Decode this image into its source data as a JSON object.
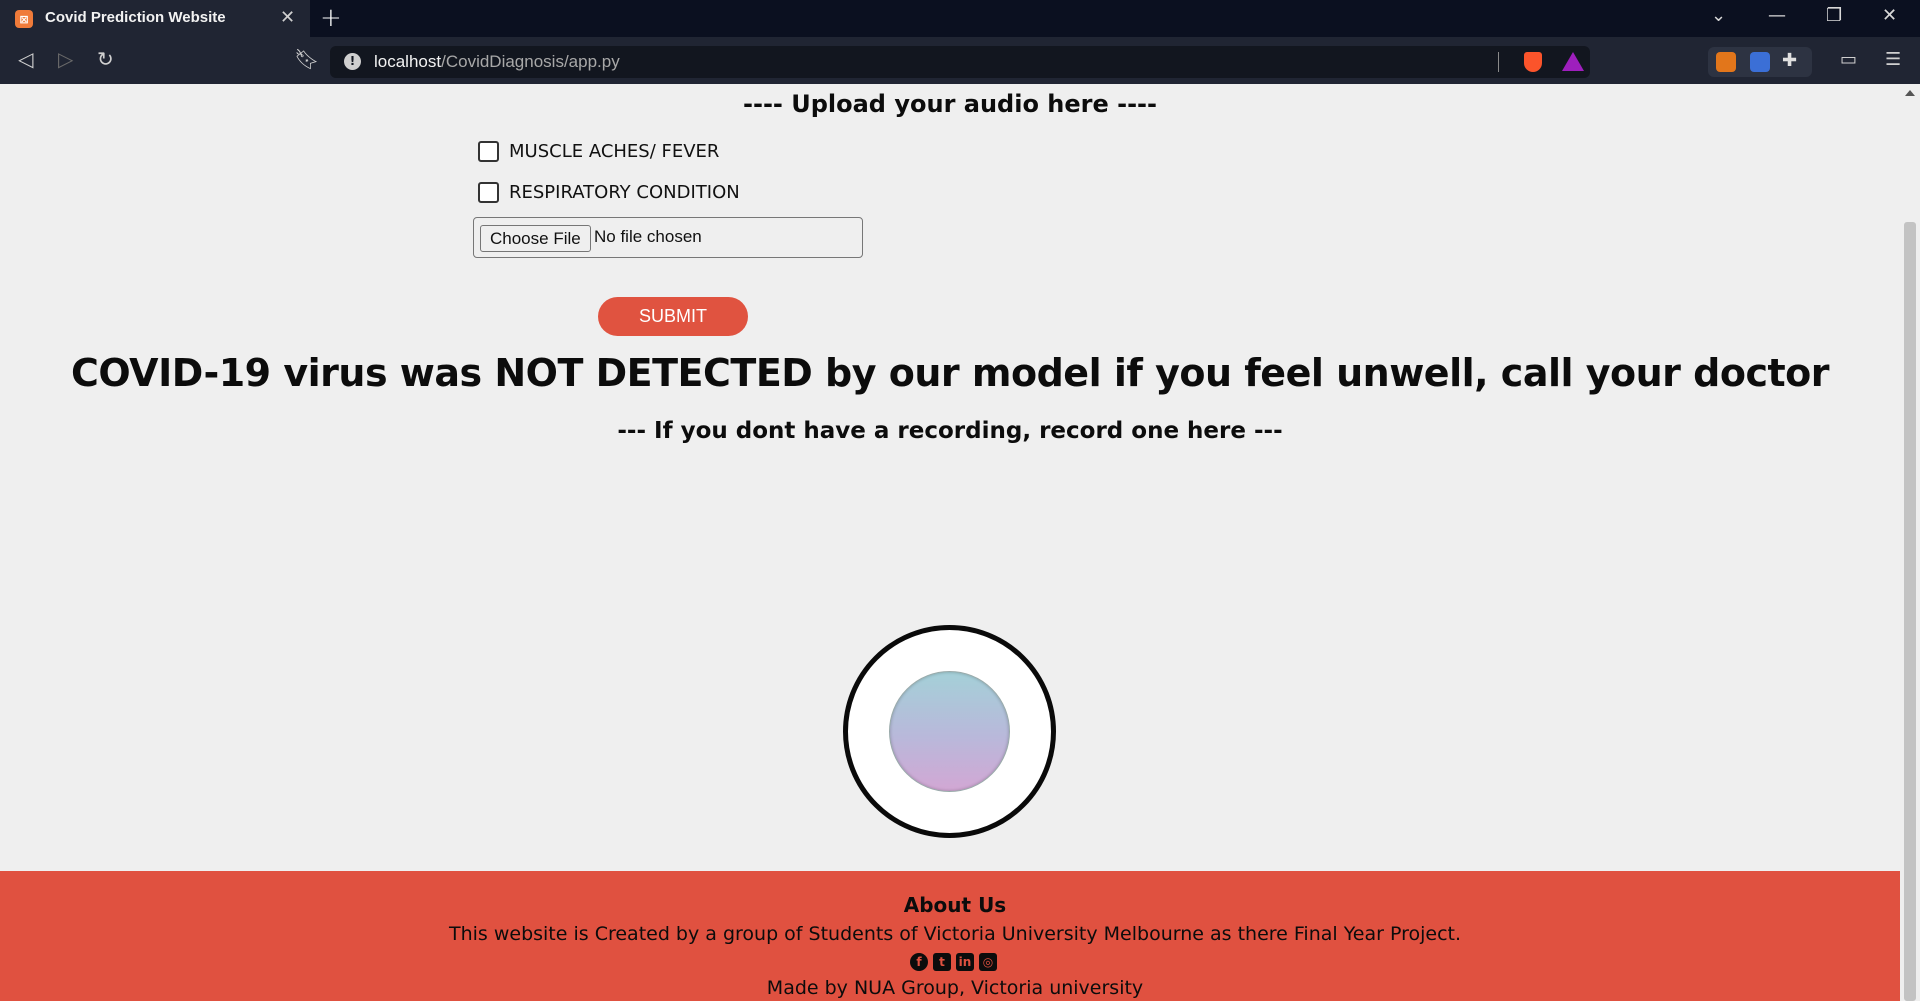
{
  "browser": {
    "tab_title": "Covid Prediction Website",
    "tab_favicon": "xampp-icon",
    "url_host": "localhost",
    "url_path": "/CovidDiagnosis/app.py"
  },
  "page": {
    "upload_title": "---- Upload your audio here ----",
    "checkboxes": [
      {
        "label": "MUSCLE ACHES/ FEVER",
        "checked": false
      },
      {
        "label": "RESPIRATORY CONDITION",
        "checked": false
      }
    ],
    "file_input": {
      "button_label": "Choose File",
      "status": "No file chosen"
    },
    "submit_label": "SUBMIT",
    "result_text": "COVID-19 virus was NOT DETECTED by our model if you feel unwell, call your doctor",
    "record_title": "--- If you dont have a recording, record one here ---"
  },
  "footer": {
    "title": "About Us",
    "description": "This website is Created by a group of Students of Victoria University Melbourne as there Final Year Project.",
    "social_icons": [
      "facebook-icon",
      "twitter-icon",
      "linkedin-icon",
      "instagram-icon"
    ],
    "made_by": "Made by NUA Group, Victoria university"
  },
  "colors": {
    "accent": "#e05340",
    "page_bg": "#efefef",
    "chrome_bg": "#202533"
  }
}
